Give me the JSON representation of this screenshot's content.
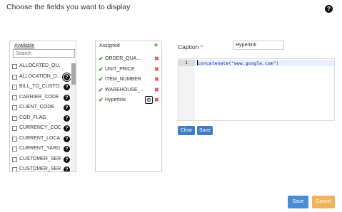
{
  "header": {
    "title": "Choose the fields you want to display",
    "help_icon": "?"
  },
  "available": {
    "heading": "Available",
    "search_placeholder": "Search",
    "items": [
      {
        "label": "ALLOCATED_QU...",
        "help": ""
      },
      {
        "label": "ALLOCATION_D...",
        "help": "?"
      },
      {
        "label": "BILL_TO_CUSTO...",
        "help": "?"
      },
      {
        "label": "CARRIER_CODE",
        "help": "?"
      },
      {
        "label": "CLIENT_CODE",
        "help": "?"
      },
      {
        "label": "COD_FLAG",
        "help": "?"
      },
      {
        "label": "CURRENCY_CODE",
        "help": "?"
      },
      {
        "label": "CURRENT_LOCA...",
        "help": "?"
      },
      {
        "label": "CURRENT_YARD...",
        "help": "?"
      },
      {
        "label": "CUSTOMER_SER...",
        "help": "?"
      },
      {
        "label": "CUSTOMER_SER...",
        "help": "?"
      }
    ]
  },
  "assigned": {
    "heading": "Assigned",
    "add_icon": "+",
    "check_icon": "✔",
    "delete_icon": "✖",
    "gear_icon": "⚙",
    "items": [
      {
        "label": "ORDER_QUA..."
      },
      {
        "label": "UNIT_PRICE"
      },
      {
        "label": "ITEM_NUMBER"
      },
      {
        "label": "WAREHOUSE_..."
      },
      {
        "label": "Hyperlink"
      }
    ]
  },
  "caption": {
    "label": "Caption",
    "required_mark": "*",
    "value": "Hyperlink"
  },
  "editor": {
    "line_number": "1",
    "code_fn": "concatenate",
    "code_open": "(",
    "code_str": "\"www.google.com\"",
    "code_close": ")"
  },
  "buttons": {
    "clear": "Clear",
    "save_small": "Save",
    "save": "Save",
    "cancel": "Cancel"
  },
  "colors": {
    "primary": "#3f7cc7",
    "warning": "#f0b25a",
    "check": "#2e9e2e",
    "delete": "#d9534f"
  }
}
